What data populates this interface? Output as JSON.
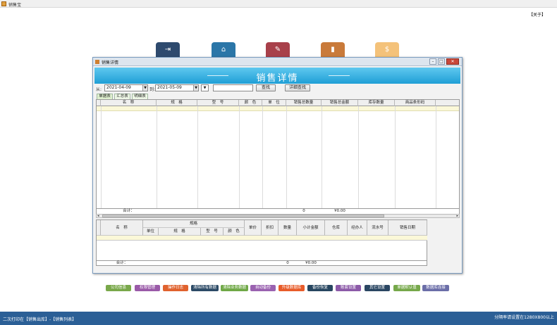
{
  "app": {
    "title": "销售宝",
    "about": "【关于】"
  },
  "menu_icons": [
    {
      "name": "exit-icon",
      "color": "#2e4a6e",
      "glyph": "⇥"
    },
    {
      "name": "warehouse-icon",
      "color": "#2b76a8",
      "glyph": "⌂"
    },
    {
      "name": "edit-icon",
      "color": "#a8404a",
      "glyph": "✎"
    },
    {
      "name": "chart-icon",
      "color": "#c97a3a",
      "glyph": "▮"
    },
    {
      "name": "money-icon",
      "color": "#f4c27a",
      "glyph": "$"
    }
  ],
  "window": {
    "title": "销售详情",
    "banner_title": "销售详情",
    "filter": {
      "from_label": "从:",
      "from_date": "2021-04-09",
      "to_label": "到:",
      "to_date": "2021-05-09",
      "search_value": "",
      "search_button": "查找",
      "detail_search_button": "详细查找"
    },
    "tabs": [
      "单据表",
      "汇总表",
      "明细表"
    ],
    "grid1": {
      "columns": [
        "名　称",
        "规　格",
        "型　号",
        "颜　色",
        "单　位",
        "销售总数量",
        "销售总金额",
        "库存数量",
        "商品条形码"
      ],
      "sum_label": "合计：",
      "sum_qty": "0",
      "sum_amount": "¥0.00"
    },
    "grid2": {
      "spec_group": "规格",
      "columns": [
        "名　称",
        "单位",
        "规　格",
        "型　号",
        "颜　色",
        "单价",
        "折扣",
        "数量",
        "小计金额",
        "仓库",
        "经办人",
        "流水号",
        "销售日期"
      ],
      "sum_label": "合计：",
      "sum_qty": "0",
      "sum_amount": "¥0.00"
    }
  },
  "function_buttons": [
    {
      "label": "公司信息",
      "color": "#79a84a"
    },
    {
      "label": "权限管理",
      "color": "#9a5aa8"
    },
    {
      "label": "操作日志",
      "color": "#e0622e"
    },
    {
      "label": "清除所有数据",
      "color": "#2c4a66"
    },
    {
      "label": "清除业务数据",
      "color": "#6fa846"
    },
    {
      "label": "自动备份",
      "color": "#9a62b0"
    },
    {
      "label": "升级数据库",
      "color": "#e85c2a"
    },
    {
      "label": "备份恢复",
      "color": "#274660"
    },
    {
      "label": "账套设置",
      "color": "#8c5aa8"
    },
    {
      "label": "其它设置",
      "color": "#2a4662"
    },
    {
      "label": "单据默认值",
      "color": "#76a84a"
    },
    {
      "label": "数据库连接",
      "color": "#6b6ea8"
    }
  ],
  "status": {
    "left": "二次打印在【销售出库】-【销售列表】",
    "right": "分隔率请设置在1280X800以上"
  }
}
